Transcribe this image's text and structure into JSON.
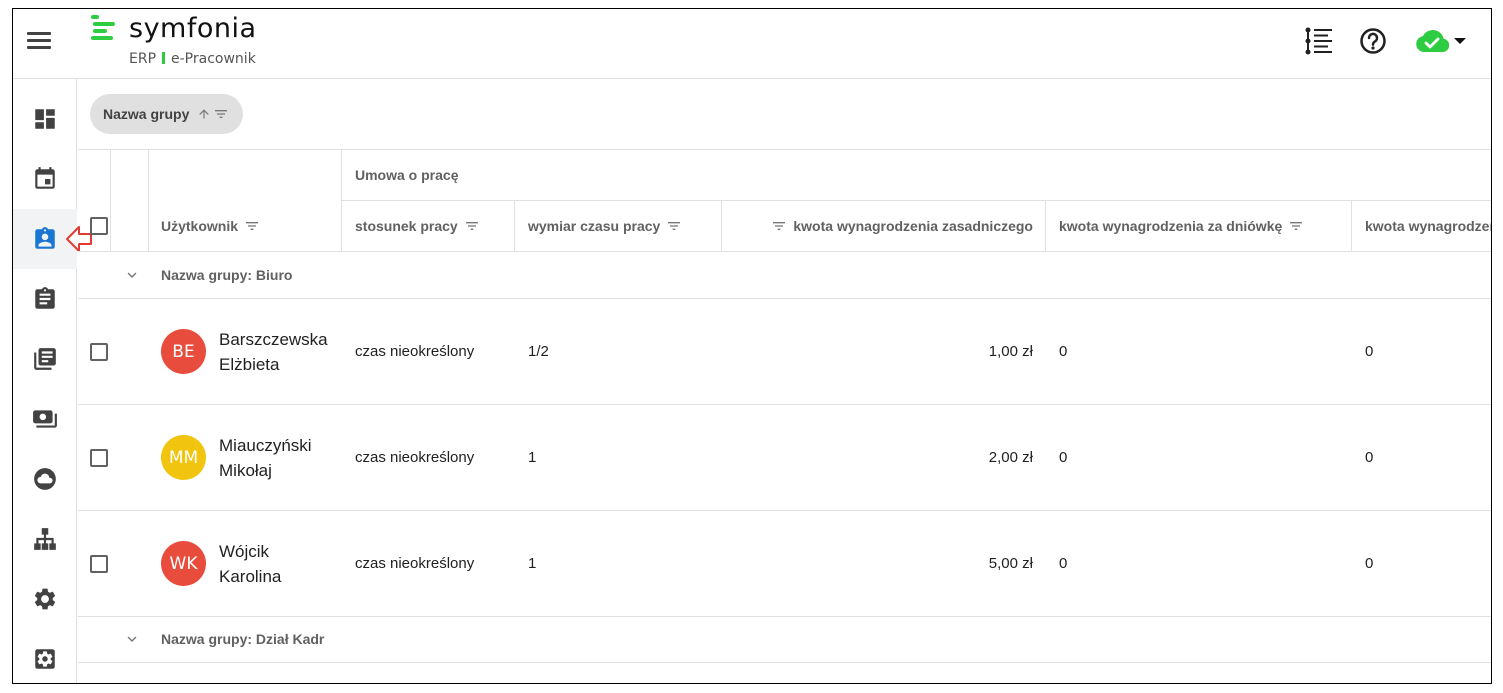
{
  "brand": {
    "name": "symfonia",
    "sub_left": "ERP",
    "sub_right": "e-Pracownik",
    "accent": "#2ecc40"
  },
  "sidebar": {
    "items": [
      {
        "icon": "dashboard-icon",
        "active": false
      },
      {
        "icon": "calendar-icon",
        "active": false
      },
      {
        "icon": "employee-badge-icon",
        "active": true
      },
      {
        "icon": "clipboard-icon",
        "active": false
      },
      {
        "icon": "documents-icon",
        "active": false
      },
      {
        "icon": "payments-icon",
        "active": false
      },
      {
        "icon": "cloud-icon",
        "active": false
      },
      {
        "icon": "org-chart-icon",
        "active": false
      },
      {
        "icon": "settings-icon",
        "active": false
      },
      {
        "icon": "admin-settings-icon",
        "active": false
      }
    ]
  },
  "toolbar": {
    "group_chip_label": "Nazwa grupy"
  },
  "table": {
    "header_group": "Umowa o pracę",
    "columns": {
      "user": "Użytkownik",
      "employment": "stosunek pracy",
      "working_time": "wymiar czasu pracy",
      "base_salary": "kwota wynagrodzenia zasadniczego",
      "daily_salary": "kwota wynagrodzenia za dniówkę",
      "next": "kwota wynagrodzenia"
    },
    "groups": [
      {
        "label": "Nazwa grupy: Biuro",
        "rows": [
          {
            "initials": "BE",
            "avatar_color": "#e74c3c",
            "name_line1": "Barszczewska",
            "name_line2": "Elżbieta",
            "employment": "czas nieokreślony",
            "working_time": "1/2",
            "base_salary": "1,00 zł",
            "daily_salary": "0",
            "next": "0"
          },
          {
            "initials": "MM",
            "avatar_color": "#f1c40f",
            "name_line1": "Miauczyński",
            "name_line2": "Mikołaj",
            "employment": "czas nieokreślony",
            "working_time": "1",
            "base_salary": "2,00 zł",
            "daily_salary": "0",
            "next": "0"
          },
          {
            "initials": "WK",
            "avatar_color": "#e74c3c",
            "name_line1": "Wójcik",
            "name_line2": "Karolina",
            "employment": "czas nieokreślony",
            "working_time": "1",
            "base_salary": "5,00 zł",
            "daily_salary": "0",
            "next": "0"
          }
        ]
      },
      {
        "label": "Nazwa grupy: Dział Kadr",
        "rows": []
      }
    ]
  }
}
